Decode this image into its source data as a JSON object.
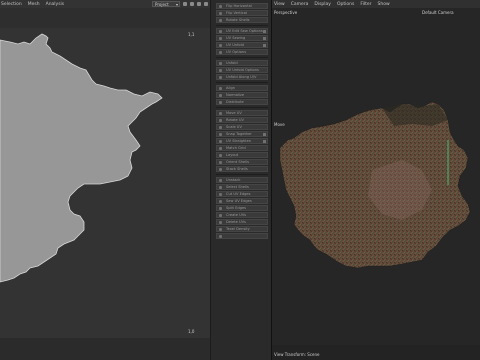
{
  "uv_editor": {
    "menu": [
      "Selection",
      "Mesh",
      "Analysis"
    ],
    "project_dropdown": "Project",
    "corner_top_right": "1,1",
    "corner_bottom_right": "1,0"
  },
  "tools": {
    "items": [
      {
        "label": "Flip Horizontal"
      },
      {
        "label": "Flip Vertical"
      },
      {
        "label": "Rotate Shells"
      },
      {
        "label": "UV Edit Sew Options"
      },
      {
        "label": "UV Sewing"
      },
      {
        "label": "UV Unfold"
      },
      {
        "label": "UV Options"
      },
      {
        "label": "Unfold"
      },
      {
        "label": "UV Unfold Options"
      },
      {
        "label": "Unfold Along U/V"
      },
      {
        "label": "Align"
      },
      {
        "label": "Normalize"
      },
      {
        "label": "Distribute"
      },
      {
        "label": "Move UV"
      },
      {
        "label": "Rotate UV"
      },
      {
        "label": "Scale UV"
      },
      {
        "label": "Snap Together"
      },
      {
        "label": "UV Straighten"
      },
      {
        "label": "Match Grid"
      },
      {
        "label": "Layout"
      },
      {
        "label": "Orient Shells"
      },
      {
        "label": "Stack Shells"
      },
      {
        "label": "Unstack"
      },
      {
        "label": "Select Shells"
      },
      {
        "label": "Cut UV Edges"
      },
      {
        "label": "Sew UV Edges"
      },
      {
        "label": "Split Edges"
      },
      {
        "label": "Create UVs"
      },
      {
        "label": "Delete UVs"
      },
      {
        "label": "Texel Density"
      }
    ]
  },
  "viewport": {
    "menu": [
      "View",
      "Camera",
      "Display",
      "Options",
      "Filter",
      "Show"
    ],
    "camera_label": "Perspective",
    "default_camera": "Default Camera",
    "axis_label": "Move",
    "scene_label": "View Transform: Scene"
  },
  "colors": {
    "uv_shape": "#979797",
    "background": "#262626"
  }
}
